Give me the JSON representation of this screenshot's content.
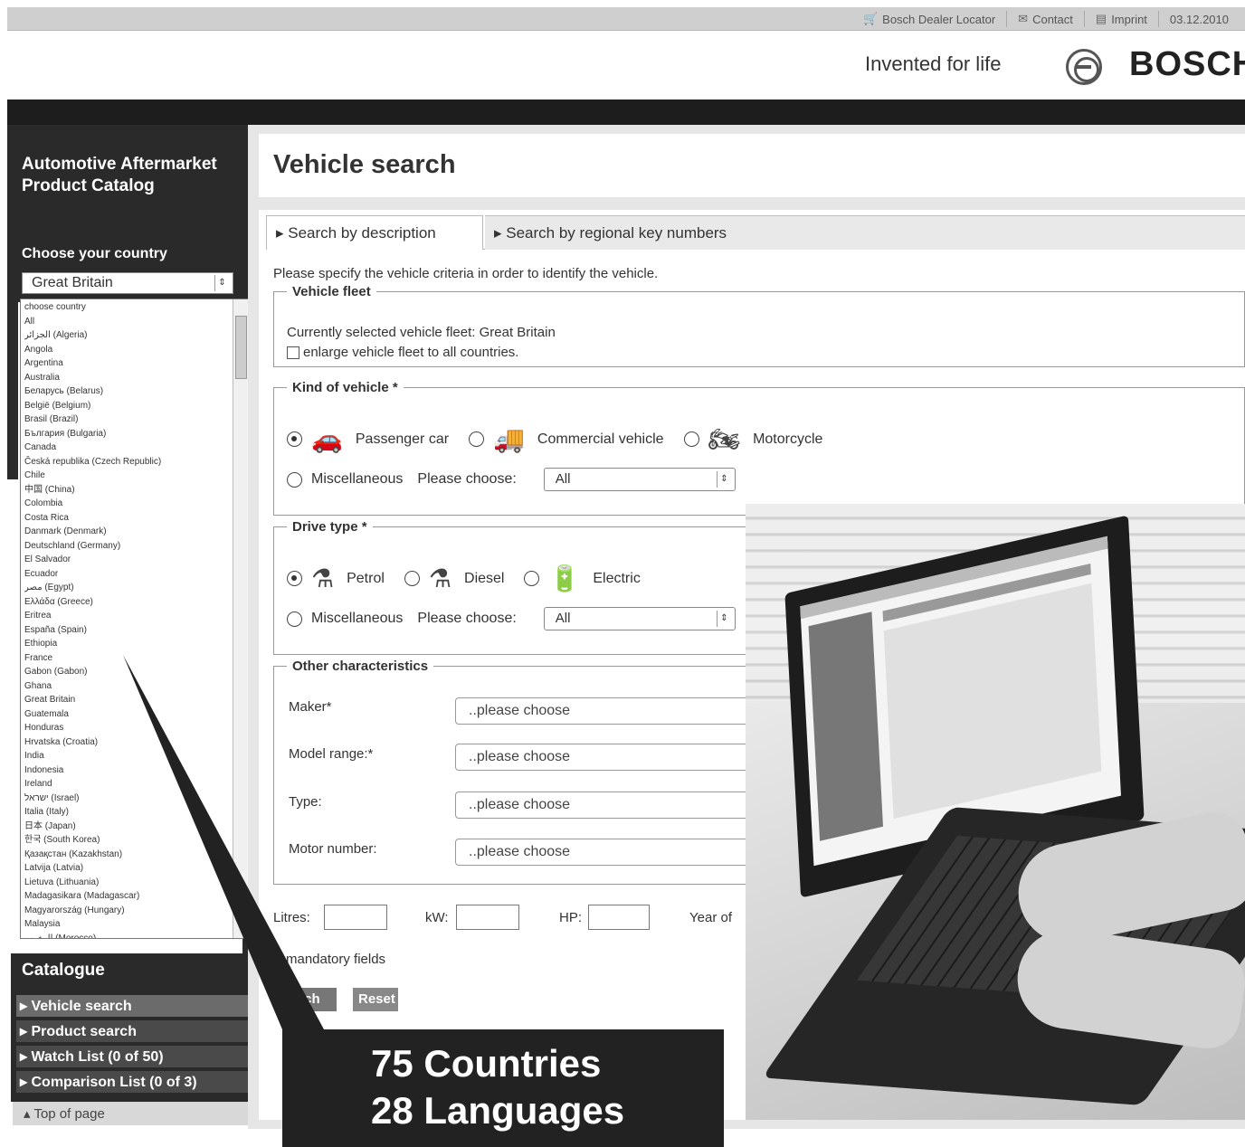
{
  "topbar": {
    "links": [
      "Bosch Dealer Locator",
      "Contact",
      "Imprint"
    ],
    "date": "03.12.2010"
  },
  "header": {
    "slogan": "Invented for life",
    "brand": "BOSCH"
  },
  "sidebar": {
    "title": "Automotive Aftermarket Product Catalog",
    "country_label": "Choose your country",
    "country_selected": "Great Britain",
    "country_options": [
      "choose country",
      "All",
      "الجزائر (Algeria)",
      "Angola",
      "Argentina",
      "Australia",
      "Беларусь (Belarus)",
      "België (Belgium)",
      "Brasil (Brazil)",
      "България (Bulgaria)",
      "Canada",
      "Česká republika (Czech Republic)",
      "Chile",
      "中国 (China)",
      "Colombia",
      "Costa Rica",
      "Danmark (Denmark)",
      "Deutschland (Germany)",
      "El Salvador",
      "Ecuador",
      "مصر (Egypt)",
      "Ελλάδα (Greece)",
      "Eritrea",
      "España (Spain)",
      "Ethiopia",
      "France",
      "Gabon (Gabon)",
      "Ghana",
      "Great Britain",
      "Guatemala",
      "Honduras",
      "Hrvatska (Croatia)",
      "India",
      "Indonesia",
      "Ireland",
      "ישראל (Israel)",
      "Italia (Italy)",
      "日本 (Japan)",
      "한국 (South Korea)",
      "Қазақстан (Kazakhstan)",
      "Latvija (Latvia)",
      "Lietuva (Lithuania)",
      "Madagasikara (Madagascar)",
      "Magyarország (Hungary)",
      "Malaysia",
      "المغرب (Morocco)"
    ],
    "catalogue": {
      "title": "Catalogue",
      "items": [
        "Vehicle search",
        "Product search",
        "Watch List (0 of 50)",
        "Comparison List (0 of 3)"
      ]
    },
    "top_of_page": "Top of page"
  },
  "main": {
    "title": "Vehicle search",
    "tabs": [
      "Search by description",
      "Search by regional key numbers"
    ],
    "intro": "Please specify the vehicle criteria in order to identify the vehicle.",
    "fleet": {
      "legend": "Vehicle fleet",
      "current": "Currently selected vehicle fleet: Great Britain",
      "enlarge": "enlarge vehicle fleet to all countries."
    },
    "kind": {
      "legend": "Kind of vehicle *",
      "options": [
        "Passenger car",
        "Commercial vehicle",
        "Motorcycle"
      ],
      "misc": "Miscellaneous",
      "please_choose": "Please choose:",
      "select_value": "All"
    },
    "drive": {
      "legend": "Drive type *",
      "options": [
        "Petrol",
        "Diesel",
        "Electric"
      ],
      "misc": "Miscellaneous",
      "please_choose": "Please choose:",
      "select_value": "All"
    },
    "other": {
      "legend": "Other characteristics",
      "fields": [
        {
          "label": "Maker*",
          "value": "..please choose"
        },
        {
          "label": "Model range:*",
          "value": "..please choose"
        },
        {
          "label": "Type:",
          "value": "..please choose"
        },
        {
          "label": "Motor number:",
          "value": "..please choose"
        }
      ]
    },
    "litres": "Litres:",
    "kw": "kW:",
    "hp": "HP:",
    "year": "Year of",
    "mandatory": "mandatory fields",
    "search_btn": "arch",
    "reset_btn": "Reset"
  },
  "callout": {
    "line1": "75 Countries",
    "line2": "28 Languages"
  }
}
